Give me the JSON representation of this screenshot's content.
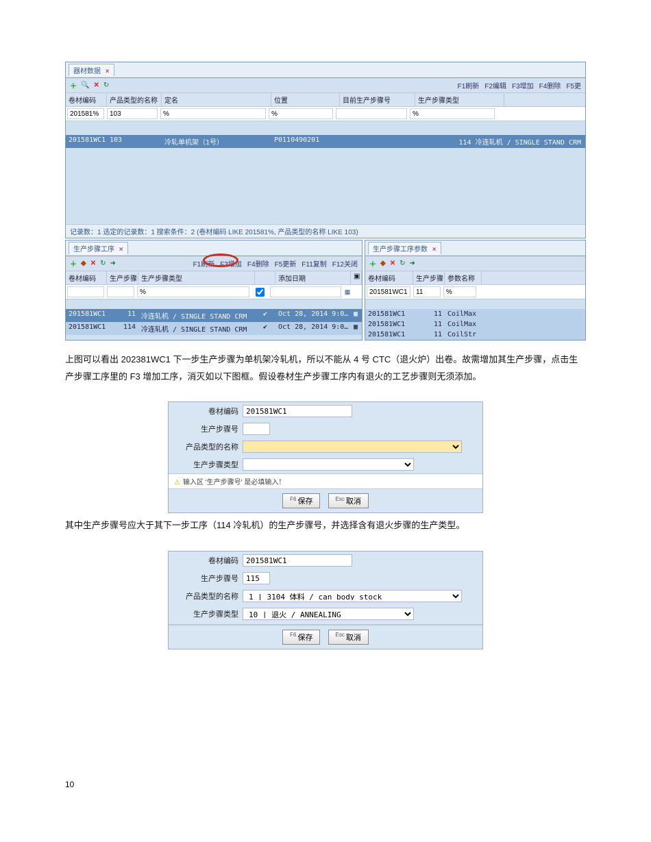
{
  "top_panel": {
    "tab": "器材数据",
    "fkeys": [
      "F1刷新",
      "F2编辑",
      "F3增加",
      "F4删除",
      "F5更"
    ],
    "cols": [
      "卷材编码",
      "产品类型的名称",
      "定名",
      "位置",
      "目前生产步骤号",
      "生产步骤类型"
    ],
    "filters": {
      "code": "201581%",
      "prod": "103",
      "name": "%",
      "pos": "%",
      "step": "",
      "type": "%"
    },
    "row": {
      "code": "201581WC1",
      "prod": "103",
      "name": "冷轧单机架（1号）",
      "pos": "P0110490201",
      "step": "",
      "type": "114 冷连轧机 / SINGLE STAND CRM"
    },
    "status": "记录数：1 选定的记录数：1 搜索条件：2 (卷材编码 LIKE 201581%, 产品类型的名称 LIKE 103)"
  },
  "left_panel": {
    "tab": "生产步骤工序",
    "fkeys": [
      "F1刷新",
      "F3增加",
      "F4删除",
      "F5更新",
      "F11复制",
      "F12关闭"
    ],
    "cols": [
      "卷材编码",
      "生产步骤号",
      "生产步骤类型",
      "",
      "添加日期",
      ""
    ],
    "filter_types": "%",
    "rows": [
      {
        "code": "201581WC1",
        "step": "11",
        "type": "冷连轧机 / SINGLE STAND CRM",
        "chk": "✔",
        "date": "Oct 28, 2014 9:0…"
      },
      {
        "code": "201581WC1",
        "step": "114",
        "type": "冷连轧机 / SINGLE STAND CRM",
        "chk": "✔",
        "date": "Oct 28, 2014 9:0…"
      }
    ]
  },
  "right_panel": {
    "tab": "生产步骤工序参数",
    "cols": [
      "卷材编码",
      "生产步骤号",
      "参数名称"
    ],
    "rows": [
      {
        "code": "201581WC1",
        "step": "11",
        "param": ""
      },
      {
        "code": "201581WC1",
        "step": "11",
        "param": "CoilMax"
      },
      {
        "code": "201581WC1",
        "step": "11",
        "param": "CoilMax"
      },
      {
        "code": "201581WC1",
        "step": "11",
        "param": "CoilStr"
      }
    ],
    "filter_param": "%"
  },
  "para1": "上图可以看出 202381WC1 下一步生产步骤为单机架冷轧机，所以不能从 4 号 CTC（退火炉）出卷。故需增加其生产步骤，点击生产步骤工序里的    F3 增加工序，消灭如以下图框。假设卷材生产步骤工序内有退火的工艺步骤则无须添加。",
  "dialog1": {
    "fields": {
      "code_label": "卷材编码",
      "code_value": "201581WC1",
      "step_label": "生产步骤号",
      "step_value": "",
      "prod_label": "产品类型的名称",
      "prod_value": "",
      "type_label": "生产步骤类型",
      "type_value": ""
    },
    "warn": "输入区 '生产步骤号' 是必填输入！",
    "save": "保存",
    "cancel": "取消"
  },
  "para2": "其中生产步骤号应大于其下一步工序（114    冷轧机）的生产步骤号，并选择含有退火步骤的生产类型。",
  "dialog2": {
    "fields": {
      "code_label": "卷材编码",
      "code_value": "201581WC1",
      "step_label": "生产步骤号",
      "step_value": "115",
      "prod_label": "产品类型的名称",
      "prod_value": "1 | 3104 体料 / can body stock",
      "type_label": "生产步骤类型",
      "type_value": "10 | 退火 / ANNEALING"
    },
    "save": "保存",
    "cancel": "取消"
  },
  "page_number": "10"
}
